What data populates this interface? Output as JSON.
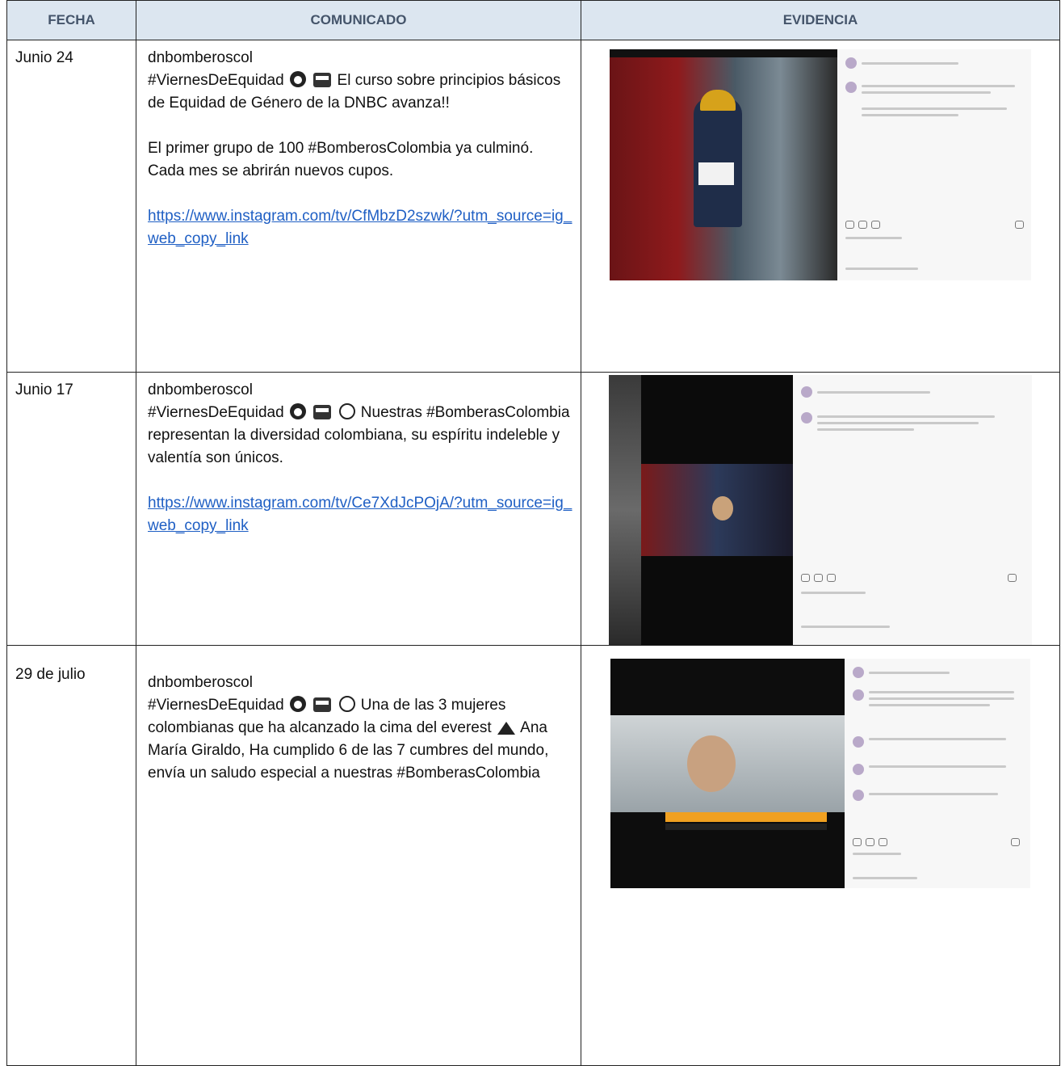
{
  "headers": [
    "FECHA",
    "COMUNICADO",
    "EVIDENCIA"
  ],
  "rows": [
    {
      "date": "Junio 24",
      "account": "dnbomberoscol",
      "line1_pre": "#ViernesDeEquidad",
      "line1_post": "El curso sobre principios básicos de Equidad de Género de la DNBC avanza!!",
      "para2": "El primer grupo de 100 #BomberosColombia ya culminó. Cada mes se abrirán nuevos cupos.",
      "link": "https://www.instagram.com/tv/CfMbzD2szwk/?utm_source=ig_web_copy_link",
      "icons": [
        "woman-face-icon",
        "fire-truck-icon"
      ]
    },
    {
      "date": "Junio 17",
      "account": "dnbomberoscol",
      "line1_pre": "#ViernesDeEquidad",
      "line1_post": "Nuestras #BomberasColombia representan la diversidad colombiana, su espíritu indeleble y valentía son únicos.",
      "link": "https://www.instagram.com/tv/Ce7XdJcPOjA/?utm_source=ig_web_copy_link",
      "icons": [
        "woman-face-icon",
        "fire-truck-icon",
        "raised-hands-icon"
      ]
    },
    {
      "date": "29 de julio",
      "account": "dnbomberoscol",
      "line1_pre": "#ViernesDeEquidad",
      "line1_mid": "Una de las 3 mujeres colombianas que ha alcanzado la cima del everest",
      "line1_post": "Ana María Giraldo, Ha cumplido 6 de las 7 cumbres del mundo, envía un saludo especial a nuestras #BomberasColombia",
      "icons": [
        "woman-face-icon",
        "fire-truck-icon",
        "person-climbing-icon",
        "mountain-icon"
      ]
    }
  ]
}
